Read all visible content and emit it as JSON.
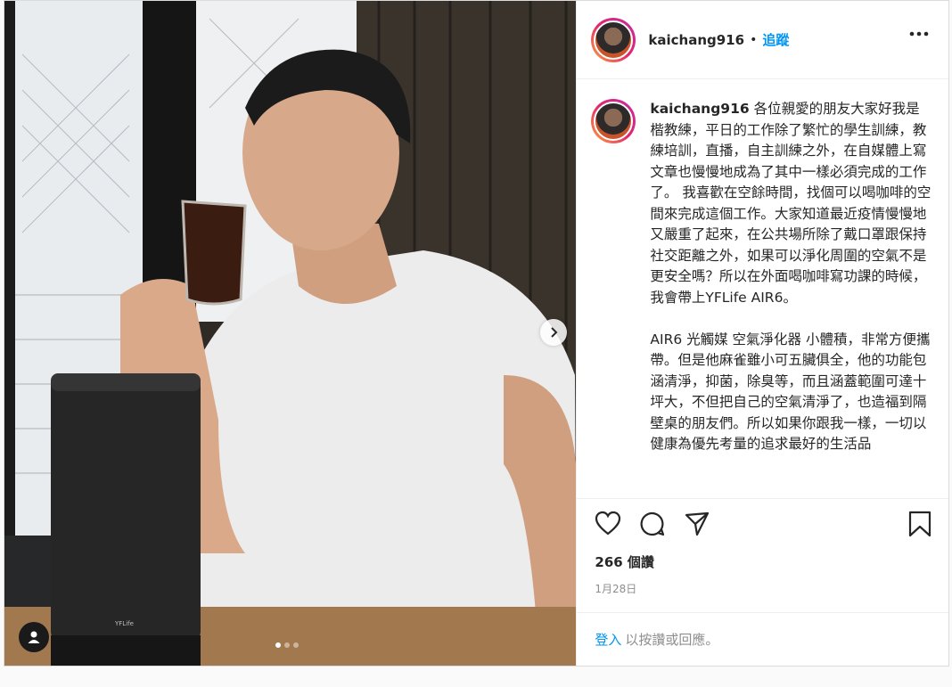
{
  "post": {
    "username": "kaichang916",
    "separator": "•",
    "follow_label": "追蹤",
    "more_icon": "more-horizontal-icon",
    "caption_user": "kaichang916",
    "caption_text": " 各位親愛的朋友大家好我是楷教練，平日的工作除了繁忙的學生訓練，教練培訓，直播，自主訓練之外，在自媒體上寫文章也慢慢地成為了其中一樣必須完成的工作了。 我喜歡在空餘時間，找個可以喝咖啡的空間來完成這個工作。大家知道最近疫情慢慢地又嚴重了起來，在公共場所除了戴口罩跟保持社交距離之外，如果可以淨化周圍的空氣不是更安全嗎？所以在外面喝咖啡寫功課的時候，我會帶上YFLife AIR6。\n\nAIR6 光觸媒 空氣淨化器 小體積，非常方便攜帶。但是他麻雀雖小可五臟俱全，他的功能包涵清淨，抑菌，除臭等，而且涵蓋範圍可達十坪大，不但把自己的空氣清淨了，也造福到隔壁桌的朋友們。所以如果你跟我一樣，一切以健康為優先考量的追求最好的生活品",
    "likes": "266 個讚",
    "date": "1月28日",
    "login_label": "登入",
    "comment_prompt": "以按讚或回應。",
    "purifier_brand": "YFLife",
    "carousel": {
      "count": 3,
      "active": 1
    },
    "icons": {
      "like": "heart-icon",
      "comment": "comment-icon",
      "share": "share-icon",
      "save": "bookmark-icon",
      "next": "chevron-right-icon",
      "tag": "user-tag-icon"
    }
  },
  "colors": {
    "accent": "#0095f6",
    "text": "#262626",
    "muted": "#8e8e8e",
    "border": "#dbdbdb"
  }
}
